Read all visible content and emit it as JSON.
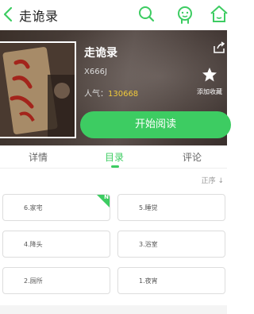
{
  "header": {
    "title": "走诡录",
    "icons": [
      "back-icon",
      "search-icon",
      "face-icon",
      "home-icon"
    ]
  },
  "book": {
    "title": "走诡录",
    "author": "X666J",
    "popularity_label": "人气：",
    "popularity_value": "130668",
    "favorite_label": "添加收藏",
    "read_button": "开始阅读"
  },
  "tabs": [
    {
      "label": "详情"
    },
    {
      "label": "目录"
    },
    {
      "label": "评论"
    }
  ],
  "toc": {
    "sort_label": "正序 ↓",
    "chapters": [
      {
        "label": "6.家宅",
        "new": true,
        "new_tag": "N"
      },
      {
        "label": "5.睡觉"
      },
      {
        "label": "4.降头"
      },
      {
        "label": "3.浴室"
      },
      {
        "label": "2.厕所"
      },
      {
        "label": "1.夜宵"
      }
    ]
  },
  "colors": {
    "accent": "#3dcc62",
    "popularity": "#f0c93a"
  }
}
